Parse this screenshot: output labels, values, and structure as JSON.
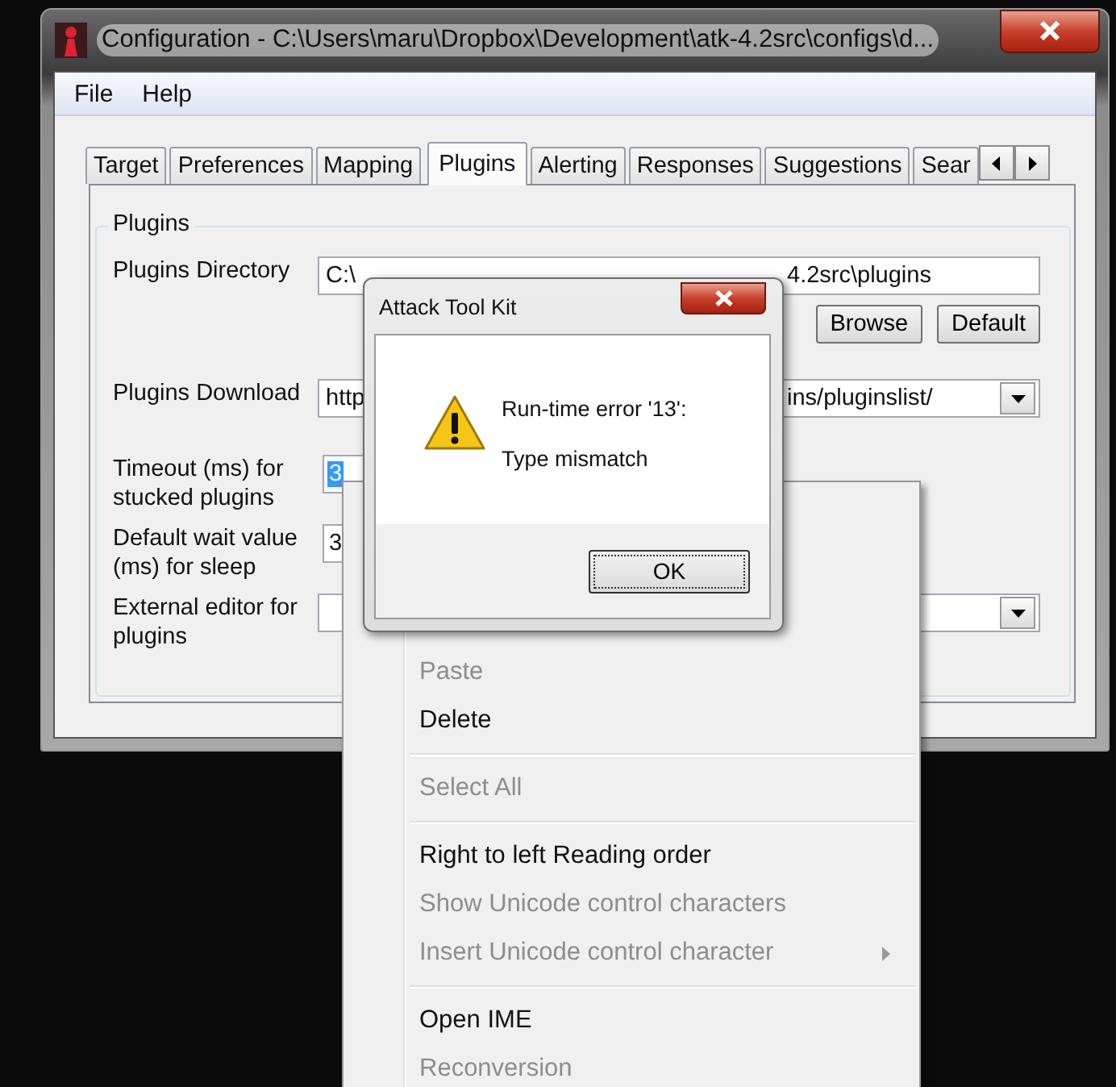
{
  "window": {
    "title": "Configuration - C:\\Users\\maru\\Dropbox\\Development\\atk-4.2src\\configs\\d..."
  },
  "menu_bar": [
    "File",
    "Help"
  ],
  "tabs": [
    {
      "label": "Target",
      "selected": false
    },
    {
      "label": "Preferences",
      "selected": false
    },
    {
      "label": "Mapping",
      "selected": false
    },
    {
      "label": "Plugins",
      "selected": true
    },
    {
      "label": "Alerting",
      "selected": false
    },
    {
      "label": "Responses",
      "selected": false
    },
    {
      "label": "Suggestions",
      "selected": false
    },
    {
      "label": "Sear",
      "selected": false
    }
  ],
  "group": {
    "title": "Plugins",
    "rows": [
      {
        "kind": "text",
        "label": "Plugins Directory",
        "value_start": "C:\\",
        "value_end": "4.2src\\plugins",
        "buttons": [
          "Browse",
          "Default"
        ]
      },
      {
        "kind": "combo",
        "label": "Plugins Download",
        "value_start": "http",
        "value_end": "ins/pluginslist/"
      },
      {
        "kind": "short",
        "label": "Timeout (ms) for stucked plugins",
        "value_start": "3",
        "selected": true
      },
      {
        "kind": "short",
        "label": "Default wait value (ms) for sleep",
        "value_start": "3",
        "selected": false
      },
      {
        "kind": "combo",
        "label": "External editor for plugins"
      }
    ]
  },
  "context_menu": [
    {
      "kind": "item",
      "label": "Paste",
      "disabled": true,
      "submenu": false
    },
    {
      "kind": "item",
      "label": "Delete",
      "disabled": false,
      "submenu": false
    },
    {
      "kind": "separator"
    },
    {
      "kind": "item",
      "label": "Select All",
      "disabled": true,
      "submenu": false
    },
    {
      "kind": "separator"
    },
    {
      "kind": "item",
      "label": "Right to left Reading order",
      "disabled": false,
      "submenu": false
    },
    {
      "kind": "item",
      "label": "Show Unicode control characters",
      "disabled": true,
      "submenu": false
    },
    {
      "kind": "item",
      "label": "Insert Unicode control character",
      "disabled": true,
      "submenu": true
    },
    {
      "kind": "separator"
    },
    {
      "kind": "item",
      "label": "Open IME",
      "disabled": false,
      "submenu": false
    },
    {
      "kind": "item",
      "label": "Reconversion",
      "disabled": true,
      "submenu": false
    }
  ],
  "dialog": {
    "title": "Attack Tool Kit",
    "message": "Run-time error '13':",
    "detail": "Type mismatch",
    "button": "OK"
  }
}
